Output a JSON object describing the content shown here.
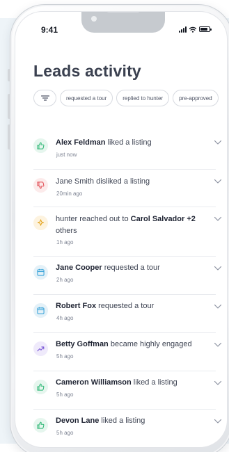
{
  "status": {
    "time": "9:41"
  },
  "page": {
    "title": "Leads activity"
  },
  "filters": [
    {
      "label": "requested a tour"
    },
    {
      "label": "replied to hunter"
    },
    {
      "label": "pre-approved"
    }
  ],
  "activities": [
    {
      "icon": "thumbs-up-icon",
      "color": "#2bb673",
      "bg": "#e6f6ee",
      "bold_start": "Alex Feldman",
      "text": " liked a listing",
      "bold_end": "",
      "time": "just now"
    },
    {
      "icon": "thumbs-down-icon",
      "color": "#e04a52",
      "bg": "#fcebeb",
      "bold_start": "",
      "text": "Jane Smith disliked a listing",
      "bold_end": "",
      "time": "20min ago"
    },
    {
      "icon": "sparkle-icon",
      "color": "#e3a21a",
      "bg": "#fdf3df",
      "bold_start": "",
      "text": "hunter reached out to ",
      "bold_end": "Carol Salvador +2",
      "text_after": " others",
      "time": "1h ago"
    },
    {
      "icon": "calendar-icon",
      "color": "#2f9fd8",
      "bg": "#e4f1f8",
      "bold_start": "Jane Cooper",
      "text": " requested a tour",
      "bold_end": "",
      "time": "2h ago"
    },
    {
      "icon": "calendar-icon",
      "color": "#2f9fd8",
      "bg": "#e4f1f8",
      "bold_start": "Robert Fox",
      "text": " requested a tour",
      "bold_end": "",
      "time": "4h ago"
    },
    {
      "icon": "trending-up-icon",
      "color": "#7a58d6",
      "bg": "#efeafb",
      "bold_start": "Betty Goffman",
      "text": " became highly engaged",
      "bold_end": "",
      "time": "5h ago"
    },
    {
      "icon": "thumbs-up-icon",
      "color": "#2bb673",
      "bg": "#e6f6ee",
      "bold_start": "Cameron Williamson",
      "text": " liked a listing",
      "bold_end": "",
      "time": "5h ago"
    },
    {
      "icon": "thumbs-up-icon",
      "color": "#2bb673",
      "bg": "#e6f6ee",
      "bold_start": "Devon Lane",
      "text": " liked a listing",
      "bold_end": "",
      "time": "5h ago"
    }
  ]
}
